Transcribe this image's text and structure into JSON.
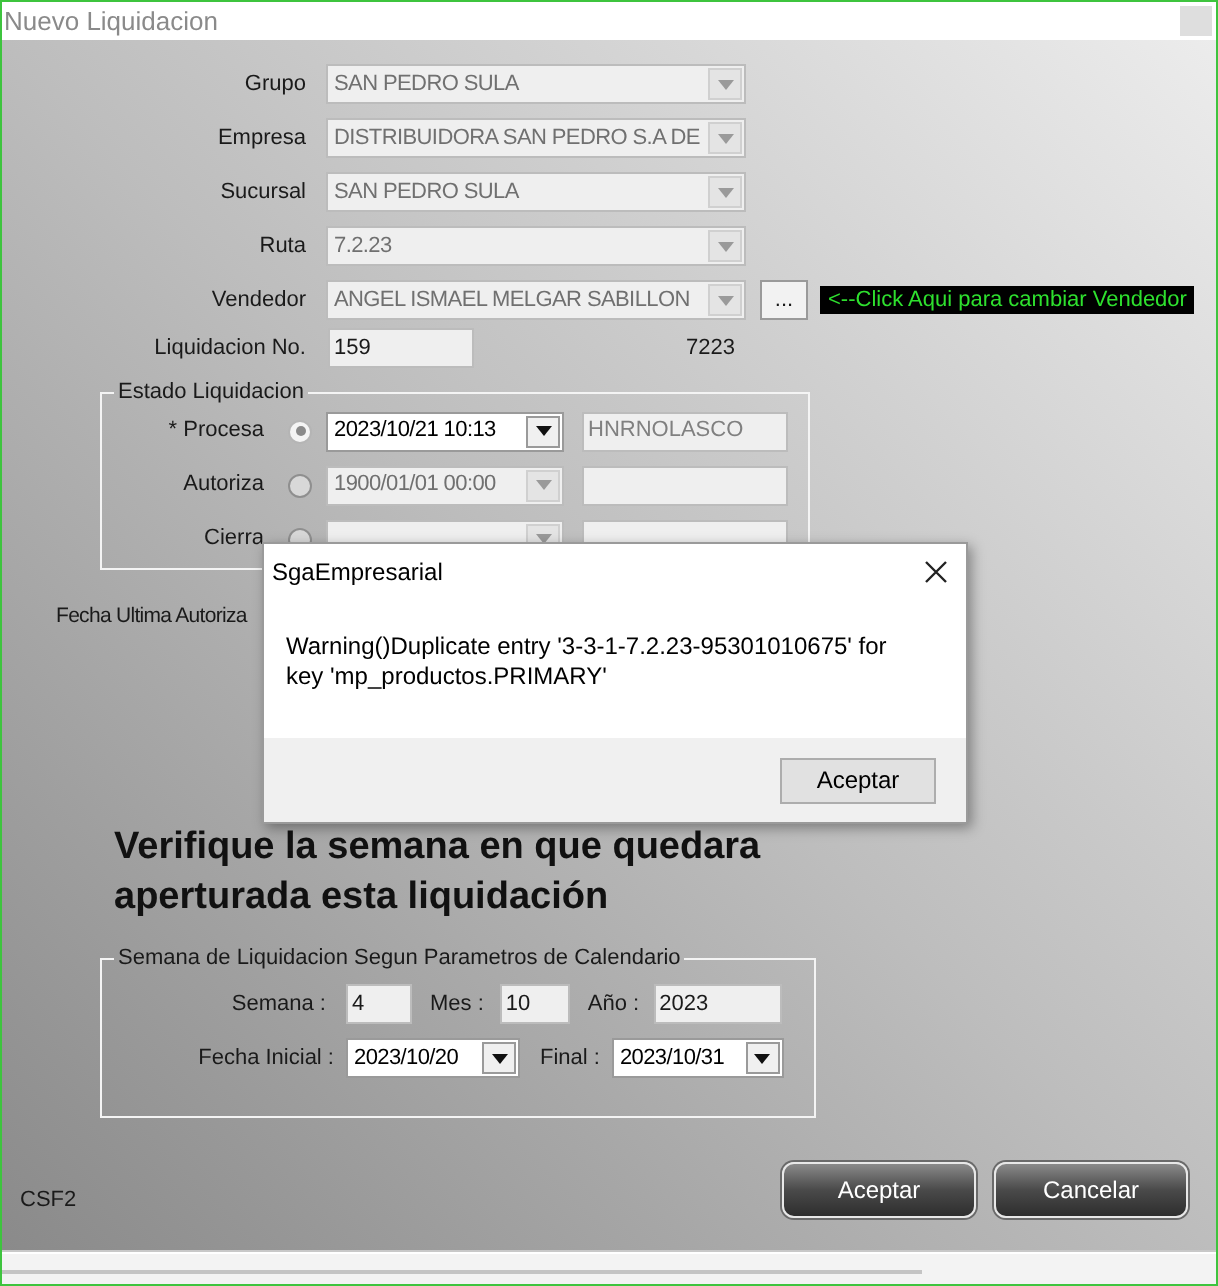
{
  "window": {
    "title": "Nuevo Liquidacion"
  },
  "fields": [
    {
      "label": "Grupo",
      "value": "SAN PEDRO SULA"
    },
    {
      "label": "Empresa",
      "value": "DISTRIBUIDORA SAN PEDRO S.A DE"
    },
    {
      "label": "Sucursal",
      "value": "SAN PEDRO SULA"
    },
    {
      "label": "Ruta",
      "value": "7.2.23"
    },
    {
      "label": "Vendedor",
      "value": "ANGEL ISMAEL MELGAR SABILLON",
      "button": "...",
      "hint": "<--Click Aqui para cambiar Vendedor"
    }
  ],
  "liquidacion": {
    "label": "Liquidacion No.",
    "value": "159",
    "code": "7223"
  },
  "estado": {
    "title": "Estado Liquidacion",
    "rows": [
      {
        "label": "* Procesa",
        "selected": true,
        "disabled": false,
        "date": "2023/10/21 10:13",
        "user": "HNRNOLASCO"
      },
      {
        "label": "Autoriza",
        "selected": false,
        "disabled": true,
        "date": "1900/01/01 00:00"
      },
      {
        "label": "Cierra",
        "selected": false,
        "disabled": true
      }
    ]
  },
  "fecha_ultima": {
    "label": "Fecha Ultima Autoriza"
  },
  "heading": "Verifique la semana en que quedara aperturada esta liquidación",
  "semana": {
    "title": "Semana de Liquidacion Segun Parametros de Calendario",
    "semana_label": "Semana :",
    "semana": "4",
    "mes_label": "Mes :",
    "mes": "10",
    "anio_label": "Año :",
    "anio": "2023",
    "inicial_label": "Fecha Inicial :",
    "inicial": "2023/10/20",
    "final_label": "Final :",
    "final": "2023/10/31"
  },
  "buttons": [
    "Aceptar",
    "Cancelar"
  ],
  "footer": "CSF2",
  "dialog": {
    "title": "SgaEmpresarial",
    "message": "Warning()Duplicate entry '3-3-1-7.2.23-95301010675' for key 'mp_productos.PRIMARY'",
    "button": "Aceptar"
  }
}
